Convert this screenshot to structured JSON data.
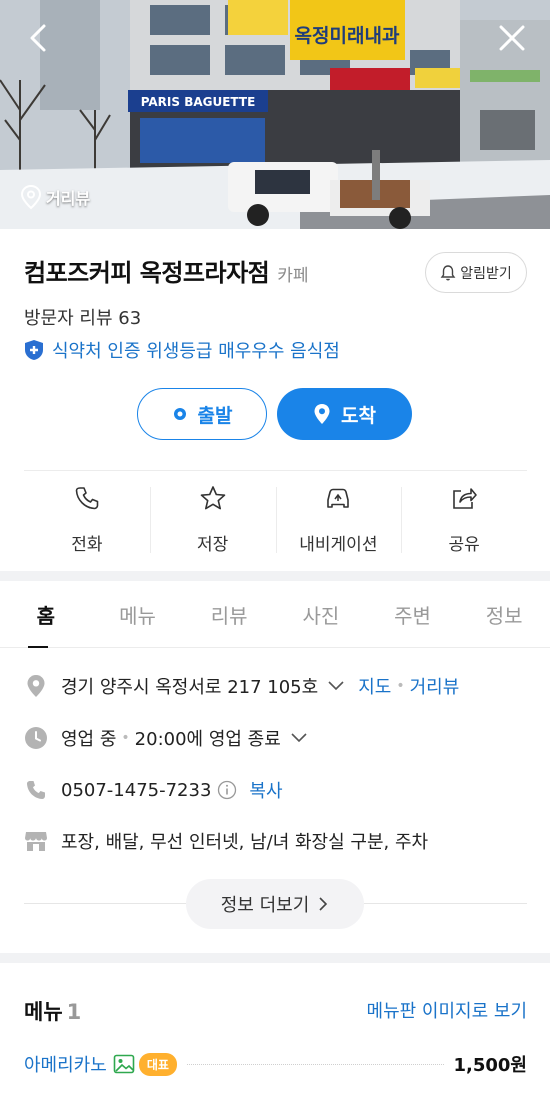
{
  "hero": {
    "streetview_label": "거리뷰",
    "storefront_sign": "PARIS BAGUETTE",
    "banner_sign": "옥정미래내과"
  },
  "place": {
    "name": "컴포즈커피 옥정프라자점",
    "category": "카페",
    "alarm_label": "알림받기",
    "review_label": "방문자 리뷰 63",
    "hygiene_label": "식약처 인증 위생등급 매우우수 음식점"
  },
  "route": {
    "depart_label": "출발",
    "arrive_label": "도착"
  },
  "actions": [
    {
      "label": "전화",
      "icon": "phone-icon"
    },
    {
      "label": "저장",
      "icon": "star-icon"
    },
    {
      "label": "내비게이션",
      "icon": "car-navigation-icon"
    },
    {
      "label": "공유",
      "icon": "share-icon"
    }
  ],
  "tabs": [
    "홈",
    "메뉴",
    "리뷰",
    "사진",
    "주변",
    "정보"
  ],
  "info": {
    "address": "경기 양주시 옥정서로 217 105호",
    "map_link": "지도",
    "streetview_link": "거리뷰",
    "status": "영업 중",
    "hours": "20:00에 영업 종료",
    "phone": "0507-1475-7233",
    "copy_label": "복사",
    "amenities": "포장, 배달, 무선 인터넷, 남/녀 화장실 구분, 주차",
    "more_label": "정보 더보기"
  },
  "menu": {
    "title": "메뉴",
    "count": "1",
    "board_link": "메뉴판 이미지로 보기",
    "items": [
      {
        "name": "아메리카노",
        "badge": "대표",
        "price": "1,500원"
      }
    ]
  },
  "colors": {
    "accent": "#1a84e8",
    "link": "#1a73c9",
    "badge": "#ffb02e"
  }
}
